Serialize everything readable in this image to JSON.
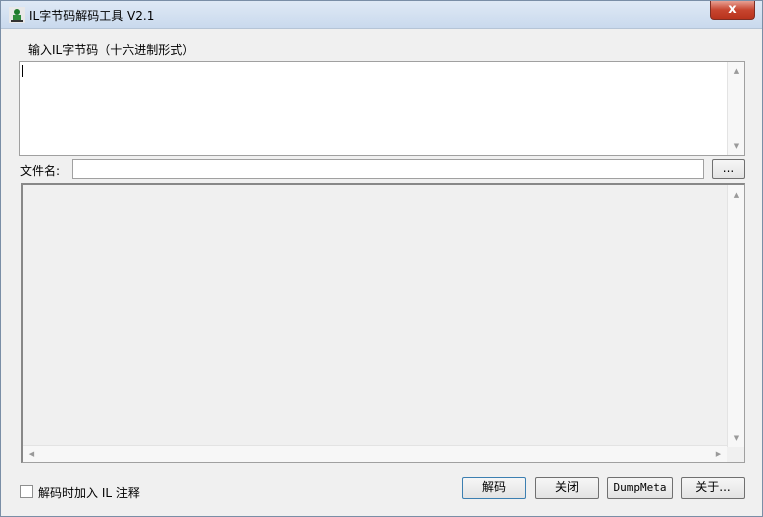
{
  "window": {
    "title": "IL字节码解码工具 V2.1",
    "close_glyph": "x"
  },
  "input_section": {
    "label": "输入IL字节码（十六进制形式）",
    "value": ""
  },
  "file_row": {
    "label": "文件名:",
    "value": "",
    "browse_label": "..."
  },
  "output": {
    "value": ""
  },
  "footer": {
    "checkbox_label": "解码时加入 IL 注释",
    "checkbox_checked": false,
    "decode_label": "解码",
    "close_label": "关闭",
    "dumpmeta_label": "DumpMeta",
    "about_label": "关于..."
  },
  "scroll_glyphs": {
    "up": "▲",
    "down": "▼",
    "left": "◀",
    "right": "▶"
  },
  "colors": {
    "titlebar": "#c9d9ed",
    "close_button": "#c7452f",
    "background": "#f0f0f0"
  }
}
